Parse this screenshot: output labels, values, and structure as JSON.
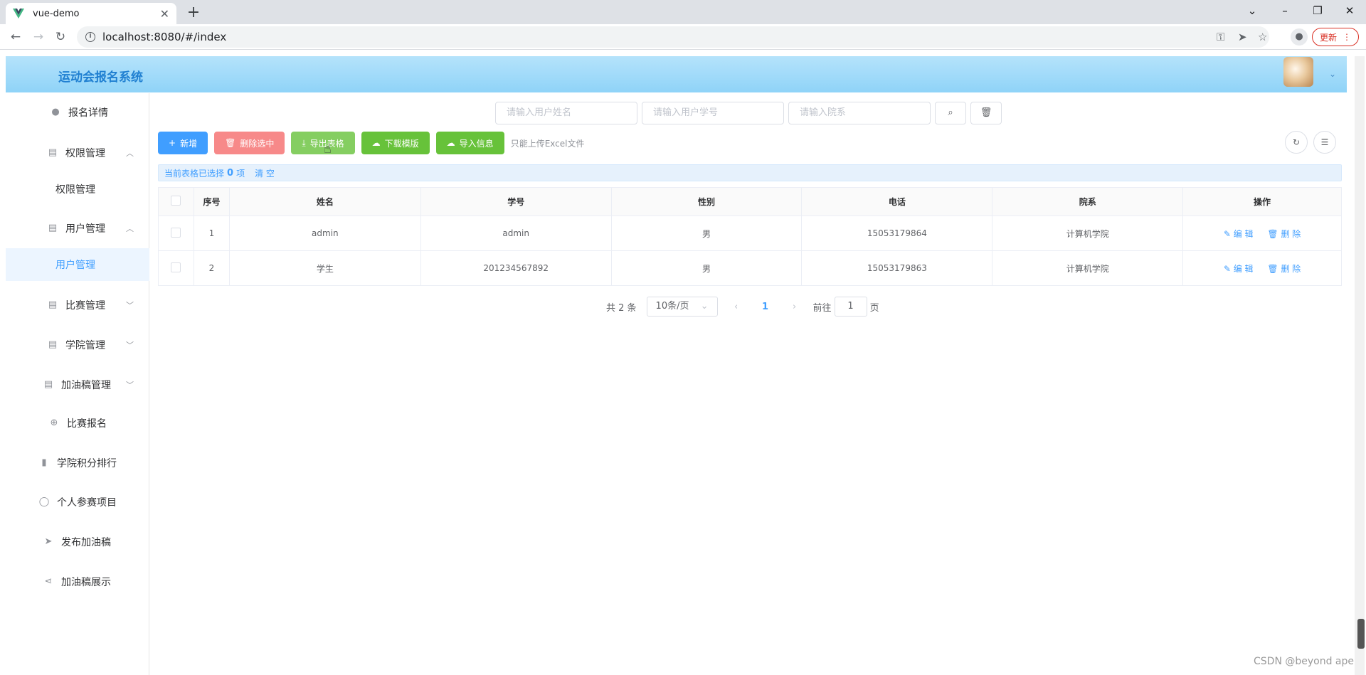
{
  "browser": {
    "tab_title": "vue-demo",
    "url": "localhost:8080/#/index",
    "update_label": "更新"
  },
  "app": {
    "title": "运动会报名系统"
  },
  "sidebar": {
    "items": [
      {
        "label": "报名详情",
        "icon": "bulb-icon"
      },
      {
        "label": "权限管理",
        "icon": "clipboard-icon",
        "expanded": true
      },
      {
        "label": "权限管理",
        "sub": true
      },
      {
        "label": "用户管理",
        "icon": "clipboard-icon",
        "expanded": true
      },
      {
        "label": "用户管理",
        "sub": true,
        "active": true
      },
      {
        "label": "比赛管理",
        "icon": "clipboard-icon"
      },
      {
        "label": "学院管理",
        "icon": "clipboard-icon"
      },
      {
        "label": "加油稿管理",
        "icon": "clipboard-icon"
      },
      {
        "label": "比赛报名",
        "icon": "plus-circle-icon"
      },
      {
        "label": "学院积分排行",
        "icon": "bar-chart-icon"
      },
      {
        "label": "个人参赛项目",
        "icon": "user-icon"
      },
      {
        "label": "发布加油稿",
        "icon": "send-icon"
      },
      {
        "label": "加油稿展示",
        "icon": "share-icon"
      }
    ]
  },
  "search": {
    "name_placeholder": "请输入用户姓名",
    "id_placeholder": "请输入用户学号",
    "dept_placeholder": "请输入院系"
  },
  "actions": {
    "add": "新增",
    "delete_selected": "删除选中",
    "export": "导出表格",
    "download_template": "下载模版",
    "import": "导入信息",
    "upload_tip": "只能上传Excel文件"
  },
  "selection": {
    "prefix": "当前表格已选择",
    "count": "0",
    "suffix": "项",
    "clear": "清 空"
  },
  "table": {
    "columns": [
      "序号",
      "姓名",
      "学号",
      "性别",
      "电话",
      "院系",
      "操作"
    ],
    "rows": [
      {
        "index": "1",
        "name": "admin",
        "sid": "admin",
        "gender": "男",
        "phone": "15053179864",
        "dept": "计算机学院"
      },
      {
        "index": "2",
        "name": "学生",
        "sid": "201234567892",
        "gender": "男",
        "phone": "15053179863",
        "dept": "计算机学院"
      }
    ],
    "edit_label": "编 辑",
    "delete_label": "删 除"
  },
  "pagination": {
    "total": "共 2 条",
    "page_size": "10条/页",
    "current": "1",
    "goto_prefix": "前往",
    "goto_value": "1",
    "goto_suffix": "页"
  },
  "watermark": "CSDN @beyond ape",
  "colors": {
    "primary": "#409eff",
    "danger": "#f78989",
    "success": "#67c23a",
    "header": "#8fd3f8"
  }
}
